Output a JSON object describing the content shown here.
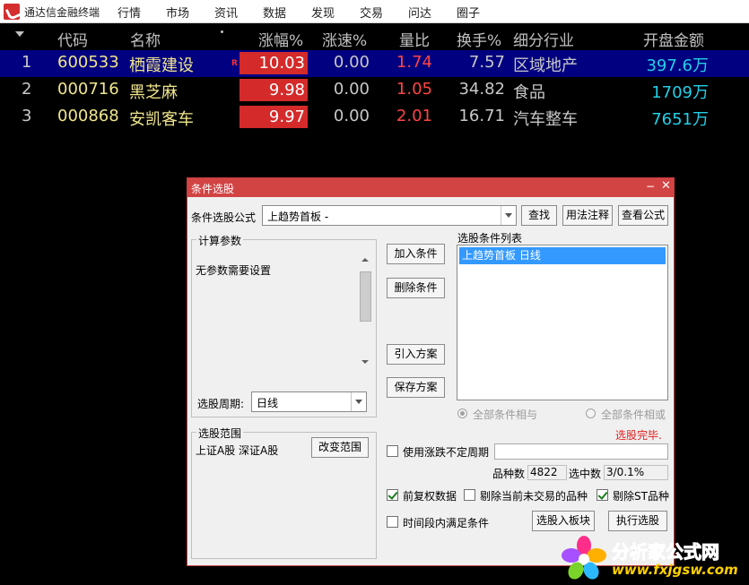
{
  "app": {
    "title": "通达信金融终端"
  },
  "menu": [
    "行情",
    "市场",
    "资讯",
    "数据",
    "发现",
    "交易",
    "问达",
    "圈子"
  ],
  "columns": {
    "code": "代码",
    "name": "名称",
    "change_pct": "涨幅%",
    "speed_pct": "涨速%",
    "volume_ratio": "量比",
    "turnover_pct": "换手%",
    "industry": "细分行业",
    "open_amount": "开盘金额"
  },
  "rows": [
    {
      "idx": "1",
      "code": "600533",
      "name": "栖霞建设",
      "flag": "R",
      "change_pct": "10.03",
      "speed_pct": "0.00",
      "volume_ratio": "1.74",
      "turnover_pct": "7.57",
      "industry": "区域地产",
      "open_amount": "397.6万"
    },
    {
      "idx": "2",
      "code": "000716",
      "name": "黑芝麻",
      "flag": "",
      "change_pct": "9.98",
      "speed_pct": "0.00",
      "volume_ratio": "1.05",
      "turnover_pct": "34.82",
      "industry": "食品",
      "open_amount": "1709万"
    },
    {
      "idx": "3",
      "code": "000868",
      "name": "安凯客车",
      "flag": "",
      "change_pct": "9.97",
      "speed_pct": "0.00",
      "volume_ratio": "2.01",
      "turnover_pct": "16.71",
      "industry": "汽车整车",
      "open_amount": "7651万"
    }
  ],
  "dialog": {
    "title": "条件选股",
    "formula_label": "条件选股公式",
    "formula_value": "上趋势首板   -",
    "find_btn": "查找",
    "usage_btn": "用法注释",
    "view_btn": "查看公式",
    "params_group": "计算参数",
    "params_text": "无参数需要设置",
    "period_label": "选股周期:",
    "period_value": "日线",
    "add_btn": "加入条件",
    "delete_btn": "删除条件",
    "import_btn": "引入方案",
    "save_btn": "保存方案",
    "list_title": "选股条件列表",
    "list_items": [
      "上趋势首板  日线"
    ],
    "radio_and": "全部条件相与",
    "radio_or": "全部条件相或",
    "status": "选股完毕.",
    "range_group": "选股范围",
    "range_text": "上证A股 深证A股",
    "change_range_btn": "改变范围",
    "use_period_label": "使用涨跌不定周期",
    "count_label": "品种数",
    "count_value": "4822",
    "selected_label": "选中数",
    "selected_value": "3/0.1%",
    "adjusted_label": "前复权数据",
    "exclude_untraded_label": "剔除当前未交易的品种",
    "exclude_st_label": "剔除ST品种",
    "time_range_label": "时间段内满足条件",
    "to_block_btn": "选股入板块",
    "execute_btn": "执行选股"
  },
  "watermark": {
    "title": "分析家公式网",
    "url": "www.fxjgsw.com"
  }
}
